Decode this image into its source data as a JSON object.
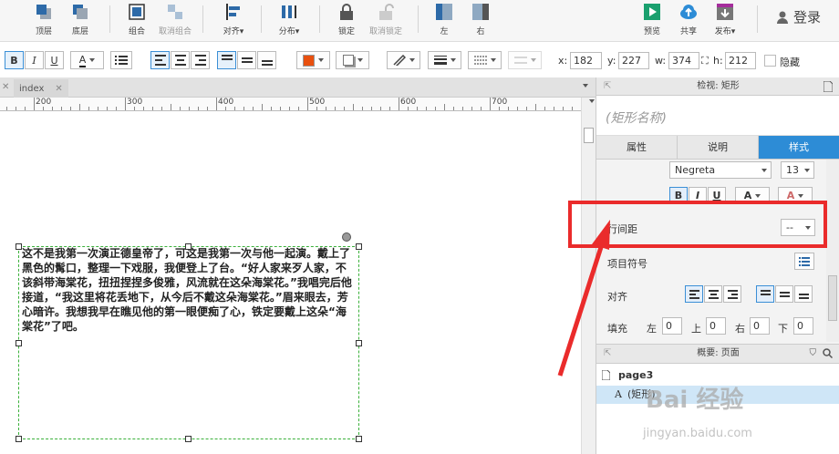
{
  "toolbar": {
    "buttons": [
      {
        "label": "顶层",
        "icon": "bring-to-front-icon"
      },
      {
        "label": "底层",
        "icon": "send-to-back-icon"
      },
      {
        "label": "组合",
        "icon": "group-icon"
      },
      {
        "label": "取消组合",
        "icon": "ungroup-icon"
      },
      {
        "label": "对齐▾",
        "icon": "align-icon"
      },
      {
        "label": "分布▾",
        "icon": "distribute-icon"
      },
      {
        "label": "锁定",
        "icon": "lock-icon"
      },
      {
        "label": "取消锁定",
        "icon": "unlock-icon"
      },
      {
        "label": "左",
        "icon": "panel-left-icon"
      },
      {
        "label": "右",
        "icon": "panel-right-icon"
      },
      {
        "label": "预览",
        "icon": "preview-icon"
      },
      {
        "label": "共享",
        "icon": "share-cloud-icon"
      },
      {
        "label": "发布▾",
        "icon": "publish-icon"
      }
    ],
    "login_label": "登录"
  },
  "formatbar": {
    "bold": "B",
    "italic": "I",
    "underline": "U",
    "font_color_letter": "A",
    "fill_color": "#e8500f",
    "x_label": "x:",
    "x_value": "182",
    "y_label": "y:",
    "y_value": "227",
    "w_label": "w:",
    "w_value": "374",
    "h_label": "h:",
    "h_value": "212",
    "hidden_label": "隐藏"
  },
  "tabs": [
    {
      "label": "index"
    }
  ],
  "ruler": {
    "labels": [
      "200",
      "300",
      "400",
      "500",
      "600",
      "700",
      "800"
    ]
  },
  "canvas": {
    "rect_text": "这不是我第一次演正德皇帝了，可这是我第一次与他一起演。戴上了黑色的髯口，整理一下戏服，我便登上了台。“好人家来歹人家，不该斜带海棠花，扭扭捏捏多俊雅，风流就在这朵海棠花。”我唱完后他接道，“我这里将花丢地下，从今后不戴这朵海棠花。”眉来眼去，芳心暗许。我想我早在瞧见他的第一眼便痴了心，铁定要戴上这朵“海棠花”了吧。"
  },
  "panel": {
    "header": "检视: 矩形",
    "name_placeholder": "(矩形名称)",
    "tabs": [
      "属性",
      "说明",
      "样式"
    ],
    "font_weight": "Negreta",
    "font_size": "13",
    "bold": "B",
    "italic": "I",
    "underline": "U",
    "font_color_letter": "A",
    "line_spacing_label": "行间距",
    "line_spacing_value": "--",
    "bullet_label": "项目符号",
    "align_label": "对齐",
    "padding_label": "填充",
    "padding_left_label": "左",
    "padding_left": "0",
    "padding_top_label": "上",
    "padding_top": "0",
    "padding_right_label": "右",
    "padding_right": "0",
    "padding_bottom_label": "下",
    "padding_bottom": "0"
  },
  "outline": {
    "header": "概要: 页面",
    "page": "page3",
    "item_glyph": "A",
    "item": "(矩形)"
  },
  "watermark": {
    "main": "Bai 经验",
    "sub": "jingyan.baidu.com"
  },
  "colors": {
    "accent": "#2d8cd6",
    "annotation": "#ea2b2b",
    "selection": "#3bb13b"
  }
}
